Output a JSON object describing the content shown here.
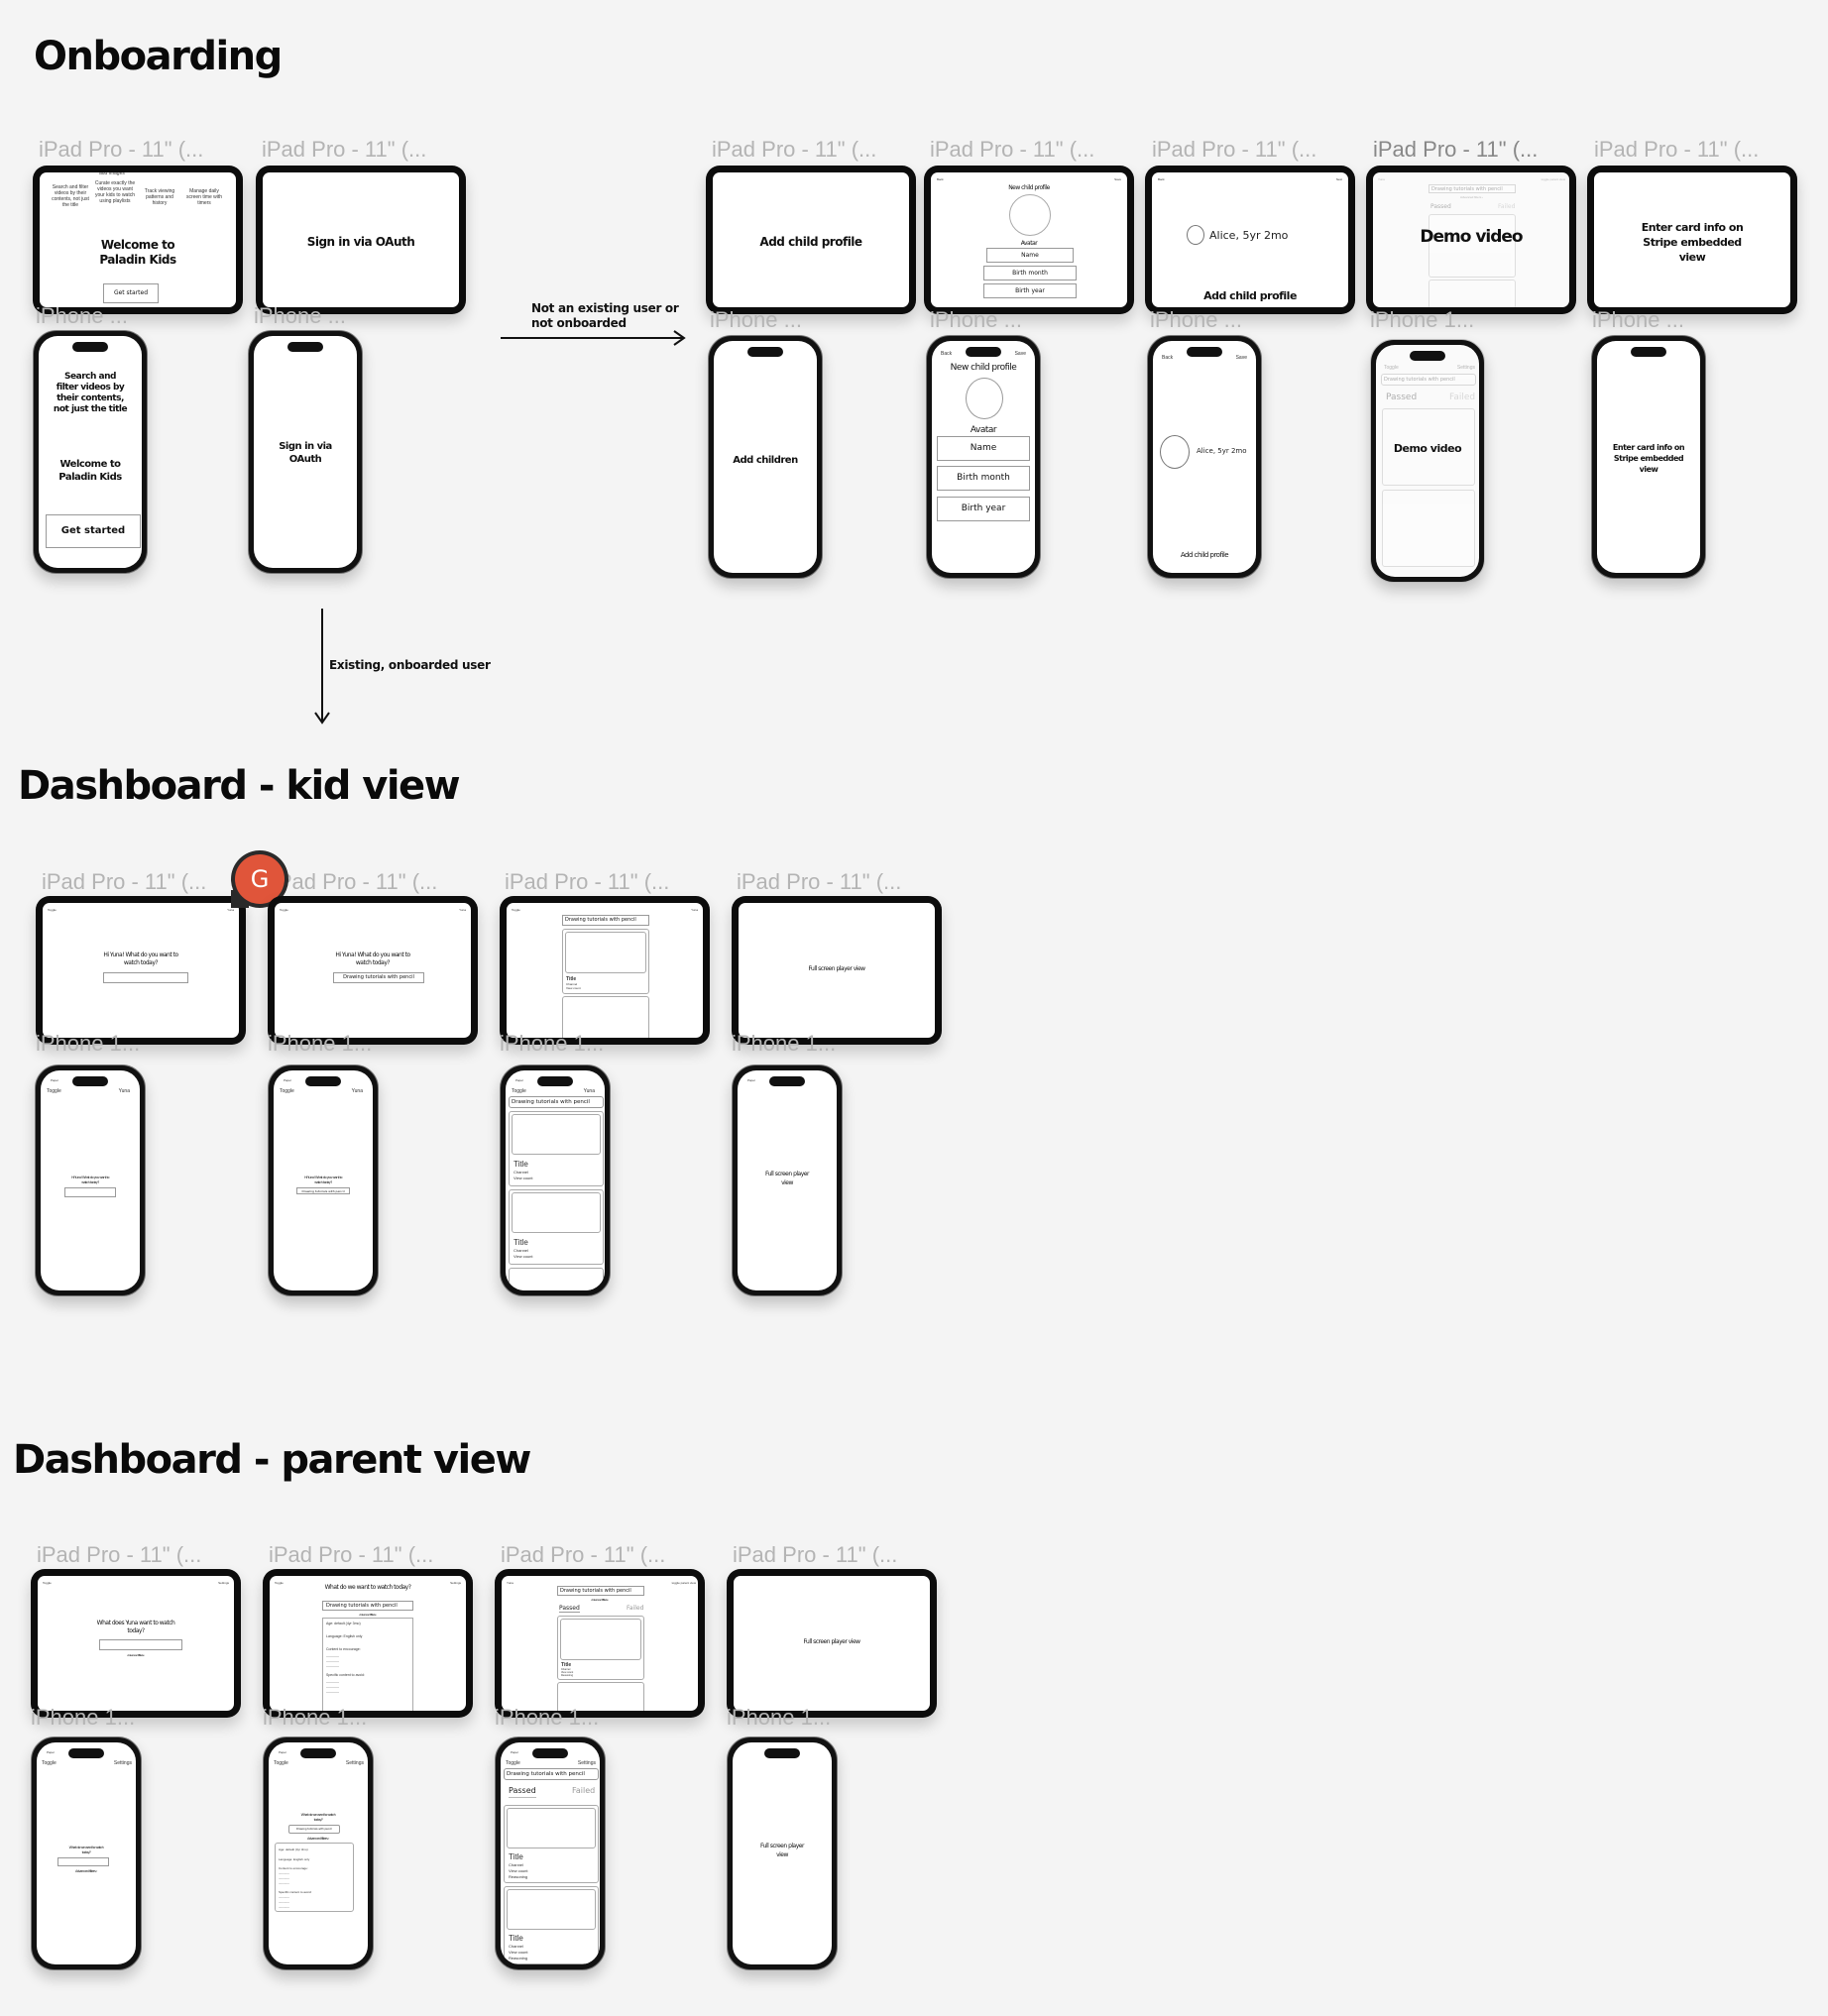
{
  "sections": {
    "onboarding": "Onboarding",
    "kid_view": "Dashboard - kid view",
    "parent_view": "Dashboard - parent view"
  },
  "labels": {
    "ipad": "iPad Pro - 11\" (...",
    "iphone": "iPhone ...",
    "iphone1": "iPhone 1..."
  },
  "flows": {
    "not_onboarded": "Not an existing user or not onboarded",
    "existing": "Existing, onboarded user"
  },
  "collaborator": {
    "initial": "G",
    "color": "#e0553a"
  },
  "common": {
    "toggle": "Toggle",
    "yuna": "Yuna",
    "settings": "Settings",
    "back": "Back",
    "save": "Save",
    "next": "Next",
    "status_time": "Paper",
    "search_query": "Drawing tutorials with pencil",
    "advanced_filters": "Advanced filters ›",
    "passed": "Passed",
    "failed": "Failed",
    "card_title": "Title",
    "card_channel": "Channel",
    "card_views": "View count",
    "card_reasoning": "Reasoning",
    "toggle_parent_view": "toggle parent view",
    "full_screen": "Full screen player view"
  },
  "onboarding": {
    "carousel_note": "Animate these in a carousel + add images",
    "features": [
      "Search and filter videos by their contents, not just the title",
      "Curate exactly the videos you want your kids to watch using playlists",
      "Track viewing patterns and history",
      "Manage daily screen time with timers"
    ],
    "welcome": "Welcome to Paladin Kids",
    "get_started": "Get started",
    "sign_in_ipad": "Sign in via OAuth",
    "sign_in_phone": "Sign in via OAuth",
    "add_child_profile": "Add child profile",
    "add_children": "Add children",
    "new_child_profile": "New child profile",
    "avatar": "Avatar",
    "name": "Name",
    "birth_month": "Birth month",
    "birth_year": "Birth year",
    "child_summary": "Alice, 5yr 2mo",
    "demo_video": "Demo video",
    "stripe": "Enter card info on Stripe embedded view"
  },
  "kid": {
    "greeting": "Hi Yuna! What do you want to watch today?",
    "search_placeholder": ""
  },
  "parent": {
    "question_yuna": "What does Yuna want to watch today?",
    "question_we": "What do we want to watch today?",
    "filters": {
      "age": "Age: default (4yr 3mo)",
      "language": "Language: English only",
      "encourage": "Content to encourage:",
      "avoid": "Specific content to avoid:",
      "placeholder_line": "-------------"
    }
  }
}
